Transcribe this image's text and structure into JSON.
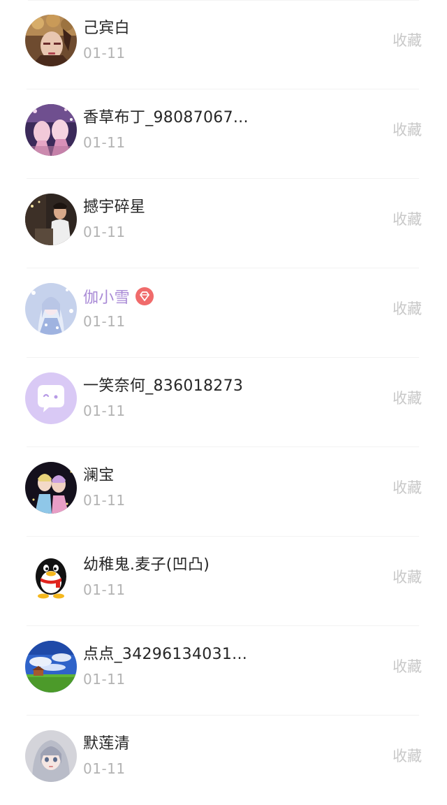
{
  "contacts": [
    {
      "name": "己宾白",
      "date": "01-11",
      "action": "收藏",
      "avatar": "avatar-photo-icon",
      "vip": false
    },
    {
      "name": "香草布丁_98087067...",
      "date": "01-11",
      "action": "收藏",
      "avatar": "avatar-photo-icon",
      "vip": false
    },
    {
      "name": "撼宇碎星",
      "date": "01-11",
      "action": "收藏",
      "avatar": "avatar-photo-icon",
      "vip": false
    },
    {
      "name": "伽小雪",
      "date": "01-11",
      "action": "收藏",
      "avatar": "avatar-photo-icon",
      "vip": true
    },
    {
      "name": "一笑奈何_836018273",
      "date": "01-11",
      "action": "收藏",
      "avatar": "chat-bubble-icon",
      "vip": false
    },
    {
      "name": "澜宝",
      "date": "01-11",
      "action": "收藏",
      "avatar": "avatar-photo-icon",
      "vip": false
    },
    {
      "name": "幼稚鬼.麦子(凹凸)",
      "date": "01-11",
      "action": "收藏",
      "avatar": "penguin-icon",
      "vip": false
    },
    {
      "name": "点点_34296134031...",
      "date": "01-11",
      "action": "收藏",
      "avatar": "landscape-icon",
      "vip": false
    },
    {
      "name": "默莲清",
      "date": "01-11",
      "action": "收藏",
      "avatar": "avatar-photo-icon",
      "vip": false
    }
  ],
  "colors": {
    "name_text": "#262626",
    "vip_name_text": "#a98ad6",
    "date_text": "#b3b3b3",
    "action_text": "#c8c8c8",
    "vip_badge": "#f06b6b",
    "default_avatar_bg": "#d9c9f5"
  }
}
